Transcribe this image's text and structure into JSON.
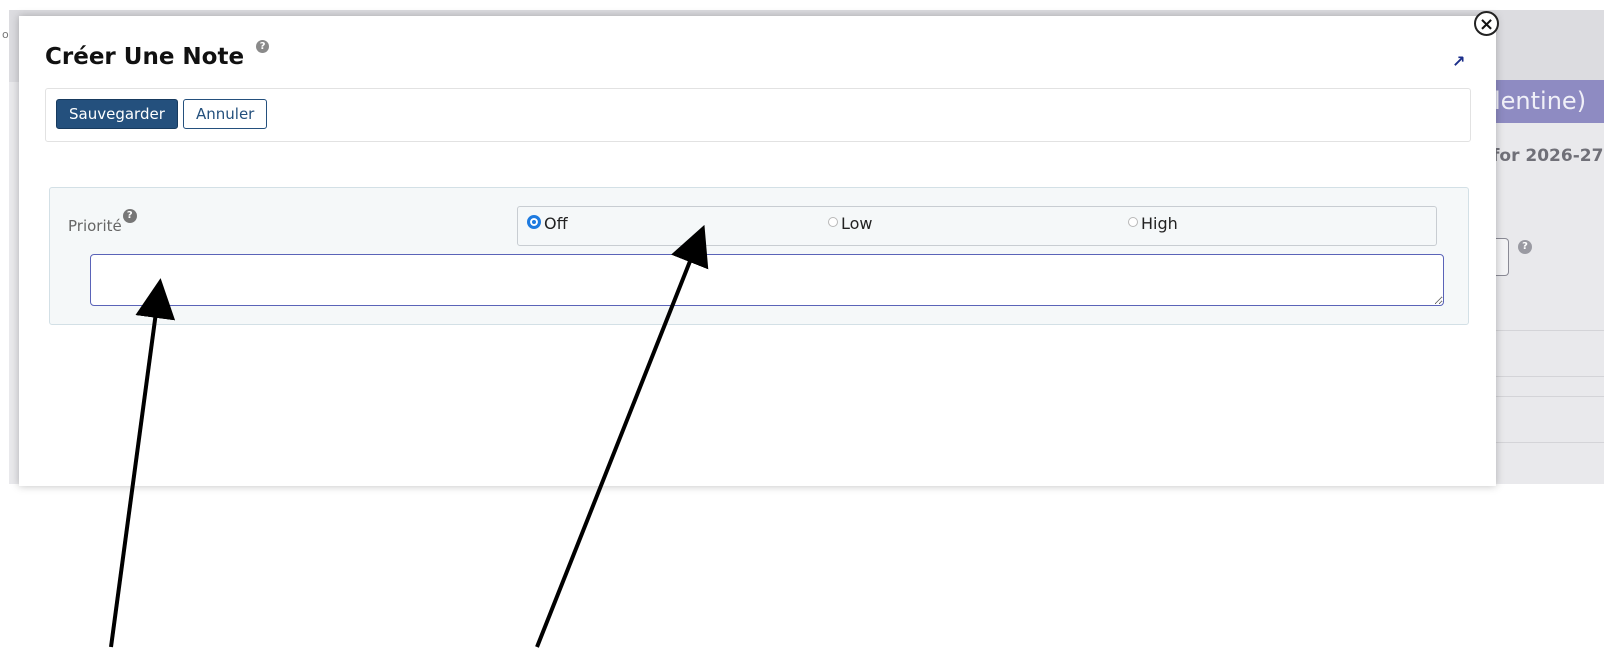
{
  "background": {
    "banner_text": "lentine)",
    "year_text": "for 2026-27",
    "corner_text": "o",
    "help_glyph": "?"
  },
  "modal": {
    "title": "Créer Une Note",
    "title_help": "?",
    "expand_icon": "↗",
    "close_icon": "×",
    "toolbar": {
      "save_label": "Sauvegarder",
      "cancel_label": "Annuler"
    },
    "priority": {
      "label": "Priorité",
      "help": "?",
      "options": [
        {
          "label": "Off",
          "selected": true
        },
        {
          "label": "Low",
          "selected": false
        },
        {
          "label": "High",
          "selected": false
        }
      ],
      "note_value": ""
    }
  },
  "colors": {
    "primary": "#24507d",
    "radio_selected": "#1e7be0",
    "input_border": "#5a63b8",
    "banner": "#8e8bc2"
  },
  "annotations": {
    "arrow_count": 2,
    "color": "#000000"
  }
}
